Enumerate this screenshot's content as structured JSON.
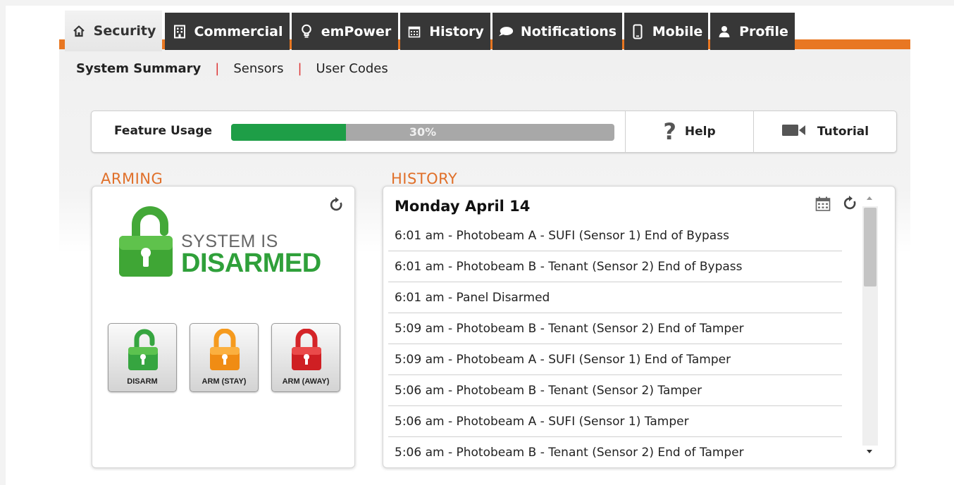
{
  "tabs": [
    {
      "label": "Security",
      "icon": "home-icon",
      "active": true
    },
    {
      "label": "Commercial",
      "icon": "building-icon",
      "active": false
    },
    {
      "label": "emPower",
      "icon": "lightbulb-icon",
      "active": false
    },
    {
      "label": "History",
      "icon": "calendar-icon",
      "active": false
    },
    {
      "label": "Notifications",
      "icon": "speech-bubble-icon",
      "active": false
    },
    {
      "label": "Mobile",
      "icon": "phone-icon",
      "active": false
    },
    {
      "label": "Profile",
      "icon": "person-icon",
      "active": false
    }
  ],
  "subnav": {
    "items": [
      {
        "label": "System Summary",
        "active": true
      },
      {
        "label": "Sensors",
        "active": false
      },
      {
        "label": "User Codes",
        "active": false
      }
    ],
    "separator": "|"
  },
  "feature_usage": {
    "label": "Feature Usage",
    "progress_text": "30%",
    "progress_fraction": 0.3,
    "help_label": "Help",
    "tutorial_label": "Tutorial"
  },
  "arming": {
    "title": "ARMING",
    "status_line1": "SYSTEM IS",
    "status_line2": "DISARMED",
    "buttons": [
      {
        "label": "DISARM",
        "color": "#36a540"
      },
      {
        "label": "ARM (STAY)",
        "color": "#f59a1e"
      },
      {
        "label": "ARM (AWAY)",
        "color": "#d42428"
      }
    ]
  },
  "history": {
    "title": "HISTORY",
    "date": "Monday April 14",
    "events": [
      "6:01 am - Photobeam A - SUFI (Sensor 1) End of Bypass",
      "6:01 am - Photobeam B - Tenant (Sensor 2) End of Bypass",
      "6:01 am - Panel Disarmed",
      "5:09 am - Photobeam B - Tenant (Sensor 2) End of Tamper",
      "5:09 am - Photobeam A - SUFI (Sensor 1) End of Tamper",
      "5:06 am - Photobeam B - Tenant (Sensor 2) Tamper",
      "5:06 am - Photobeam A - SUFI (Sensor 1) Tamper",
      "5:06 am - Photobeam B - Tenant (Sensor 2) End of Tamper"
    ]
  },
  "colors": {
    "accent_orange": "#e87722",
    "tab_dark": "#373737",
    "progress_green": "#1e9e47",
    "disarmed_green": "#2fa03a",
    "section_title": "#e0702a"
  }
}
